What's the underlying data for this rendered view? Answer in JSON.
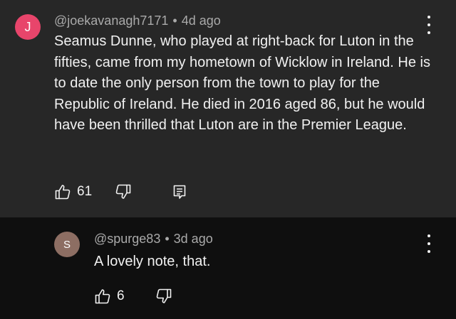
{
  "comments": [
    {
      "avatar_initial": "J",
      "avatar_color": "#e8456b",
      "handle": "@joekavanagh7171",
      "separator": "•",
      "time": "4d ago",
      "text": "Seamus Dunne, who played at right-back for Luton in the fifties, came from my hometown of Wicklow in Ireland. He is to date the only person from the town to play for the Republic of Ireland. He died in 2016 aged 86, but he would have been thrilled that Luton are in the Premier League.",
      "likes": "61",
      "icons": [
        "thumb-up-icon",
        "thumb-down-icon",
        "reply-icon",
        "more-vert-icon"
      ]
    },
    {
      "avatar_initial": "S",
      "avatar_color": "#8d6e63",
      "handle": "@spurge83",
      "separator": "•",
      "time": "3d ago",
      "text": "A lovely note, that.",
      "likes": "6",
      "icons": [
        "thumb-up-icon",
        "thumb-down-icon",
        "more-vert-icon"
      ]
    }
  ]
}
